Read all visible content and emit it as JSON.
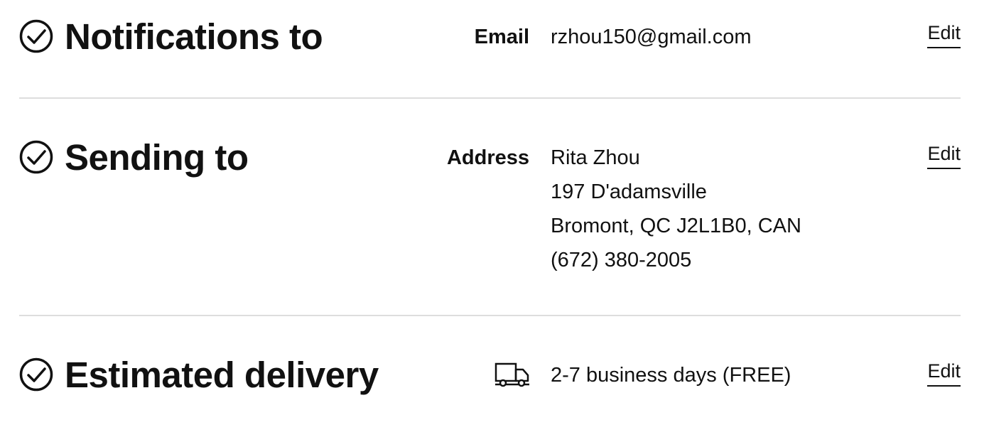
{
  "notifications": {
    "title": "Notifications to",
    "label": "Email",
    "value": "rzhou150@gmail.com",
    "edit_label": "Edit"
  },
  "sending": {
    "title": "Sending to",
    "label": "Address",
    "lines": [
      "Rita Zhou",
      "197 D'adamsville",
      "Bromont, QC J2L1B0, CAN",
      "(672) 380-2005"
    ],
    "edit_label": "Edit"
  },
  "delivery": {
    "title": "Estimated delivery",
    "value": "2-7 business days (FREE)",
    "edit_label": "Edit"
  },
  "icons": {
    "check": "check-circle-icon",
    "truck": "truck-icon"
  },
  "colors": {
    "text": "#111111",
    "divider": "#dddddd",
    "background": "#ffffff"
  }
}
